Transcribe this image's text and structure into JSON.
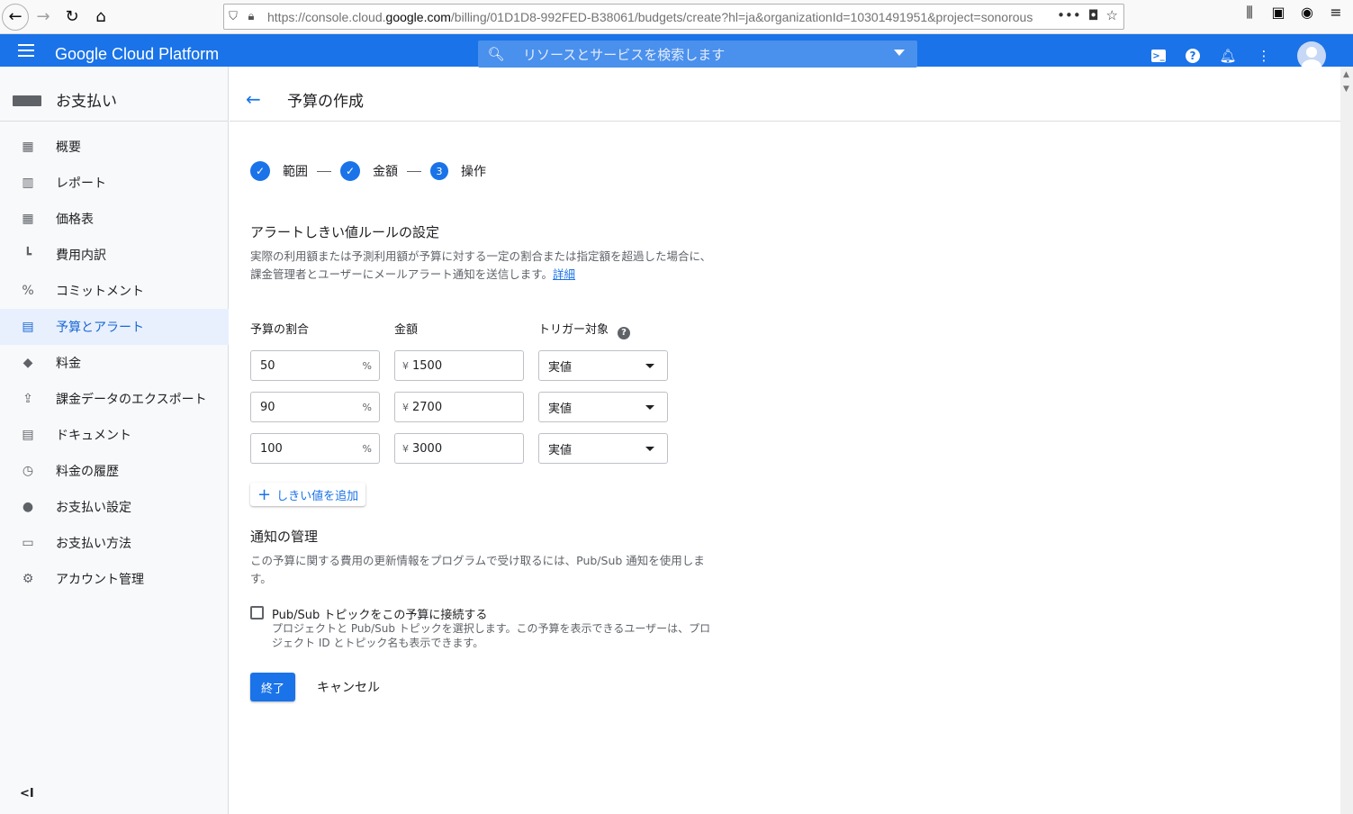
{
  "browser": {
    "url_prefix": "https://console.cloud.",
    "url_domain": "google.com",
    "url_suffix": "/billing/01D1D8-992FED-B38061/budgets/create?hl=ja&organizationId=10301491951&project=sonorous"
  },
  "header": {
    "title": "Google Cloud Platform",
    "search_placeholder": "リソースとサービスを検索します"
  },
  "sidebar": {
    "section_title": "お支払い",
    "items": [
      {
        "label": "概要",
        "icon": "dashboard-icon"
      },
      {
        "label": "レポート",
        "icon": "bar-chart-icon"
      },
      {
        "label": "価格表",
        "icon": "table-icon"
      },
      {
        "label": "費用内訳",
        "icon": "breakdown-icon"
      },
      {
        "label": "コミットメント",
        "icon": "percent-icon"
      },
      {
        "label": "予算とアラート",
        "icon": "budget-icon"
      },
      {
        "label": "料金",
        "icon": "tag-icon"
      },
      {
        "label": "課金データのエクスポート",
        "icon": "upload-icon"
      },
      {
        "label": "ドキュメント",
        "icon": "document-icon"
      },
      {
        "label": "料金の履歴",
        "icon": "history-icon"
      },
      {
        "label": "お支払い設定",
        "icon": "person-icon"
      },
      {
        "label": "お支払い方法",
        "icon": "credit-card-icon"
      },
      {
        "label": "アカウント管理",
        "icon": "gear-icon"
      }
    ],
    "active_index": 5
  },
  "page": {
    "title": "予算の作成",
    "steps": [
      {
        "label": "範囲",
        "state": "done"
      },
      {
        "label": "金額",
        "state": "done"
      },
      {
        "label": "操作",
        "state": "current",
        "number": "3"
      }
    ],
    "alert_title": "アラートしきい値ルールの設定",
    "alert_desc": "実際の利用額または予測利用額が予算に対する一定の割合または指定額を超過した場合に、課金管理者とユーザーにメールアラート通知を送信します。",
    "alert_link": "詳細",
    "col_percent": "予算の割合",
    "col_amount": "金額",
    "col_trigger": "トリガー対象",
    "percent_unit": "%",
    "currency": "¥",
    "thresholds": [
      {
        "percent": "50",
        "amount": "1500",
        "trigger": "実値"
      },
      {
        "percent": "90",
        "amount": "2700",
        "trigger": "実値"
      },
      {
        "percent": "100",
        "amount": "3000",
        "trigger": "実値"
      }
    ],
    "add_threshold": "しきい値を追加",
    "notify_title": "通知の管理",
    "notify_desc": "この予算に関する費用の更新情報をプログラムで受け取るには、Pub/Sub 通知を使用します。",
    "pubsub_label": "Pub/Sub トピックをこの予算に接続する",
    "pubsub_desc": "プロジェクトと Pub/Sub トピックを選択します。この予算を表示できるユーザーは、プロジェクト ID とトピック名も表示できます。",
    "finish": "終了",
    "cancel": "キャンセル"
  },
  "colors": {
    "accent": "#1a73e8",
    "active_bg": "#e8f0fe"
  }
}
